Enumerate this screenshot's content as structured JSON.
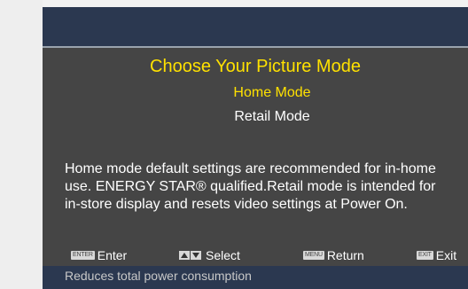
{
  "menu": {
    "title": "Choose Your Picture Mode",
    "options": [
      {
        "label": "Home Mode",
        "selected": true
      },
      {
        "label": "Retail Mode",
        "selected": false
      }
    ],
    "description_lines": [
      "Home mode default settings are recommended for in-home",
      "use. ENERGY STAR® qualified.Retail mode is intended for",
      "in-store display and resets video settings at Power On."
    ]
  },
  "nav": {
    "enter_icon": "ENTER",
    "enter_label": "Enter",
    "select_label": "Select",
    "return_icon": "MENU",
    "return_label": "Return",
    "exit_icon": "EXIT",
    "exit_label": "Exit"
  },
  "status": {
    "text": "Reduces total power consumption"
  },
  "colors": {
    "header": "#2b3850",
    "panel": "#454545",
    "highlight": "#ffe100",
    "text": "#ffffff"
  }
}
